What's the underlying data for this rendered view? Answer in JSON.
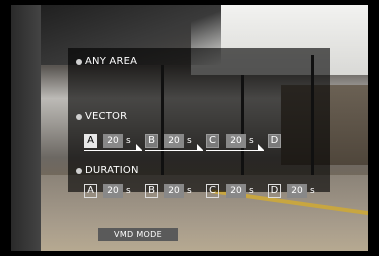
{
  "menu": {
    "any_area": "ANY AREA",
    "vector": "VECTOR",
    "duration": "DURATION"
  },
  "vector": [
    {
      "letter": "A",
      "value": "20",
      "unit": "s"
    },
    {
      "letter": "B",
      "value": "20",
      "unit": "s"
    },
    {
      "letter": "C",
      "value": "20",
      "unit": "s"
    },
    {
      "letter": "D"
    }
  ],
  "duration": [
    {
      "letter": "A",
      "value": "20",
      "unit": "s"
    },
    {
      "letter": "B",
      "value": "20",
      "unit": "s"
    },
    {
      "letter": "C",
      "value": "20",
      "unit": "s"
    },
    {
      "letter": "D",
      "value": "20",
      "unit": "s"
    }
  ],
  "footer": {
    "mode_button": "VMD MODE"
  }
}
